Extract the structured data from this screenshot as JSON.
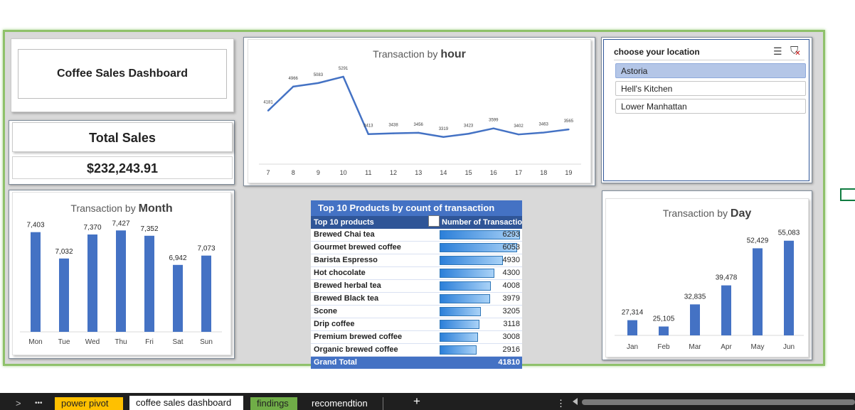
{
  "dashboard_title": "Coffee Sales Dashboard",
  "total_sales": {
    "label": "Total Sales",
    "value": "$232,243.91"
  },
  "hour_chart": {
    "title_prefix": "Transaction by ",
    "title_bold": "hour"
  },
  "month_chart": {
    "title_prefix": "Transaction by ",
    "title_bold": "Month"
  },
  "day_chart": {
    "title_prefix": "Transaction by ",
    "title_bold": "Day"
  },
  "chart_data": [
    {
      "type": "line",
      "title": "Transaction by hour",
      "x": [
        "7",
        "8",
        "9",
        "10",
        "11",
        "12",
        "13",
        "14",
        "15",
        "16",
        "17",
        "18",
        "19"
      ],
      "series": [
        {
          "values": [
            4181,
            4966,
            5083,
            5291,
            3413,
            3438,
            3456,
            3319,
            3423,
            3599,
            3402,
            3463,
            3565
          ],
          "color": "#4472c4"
        }
      ]
    },
    {
      "type": "bar",
      "title": "Transaction by Month",
      "categories": [
        "Mon",
        "Tue",
        "Wed",
        "Thu",
        "Fri",
        "Sat",
        "Sun"
      ],
      "values": [
        7403,
        7032,
        7370,
        7427,
        7352,
        6942,
        7073
      ],
      "labels": [
        "7,403",
        "7,032",
        "7,370",
        "7,427",
        "7,352",
        "6,942",
        "7,073"
      ],
      "color": "#4472c4"
    },
    {
      "type": "bar",
      "title": "Transaction by Day",
      "categories": [
        "Jan",
        "Feb",
        "Mar",
        "Apr",
        "May",
        "Jun"
      ],
      "values": [
        27314,
        25105,
        32835,
        39478,
        52429,
        55083
      ],
      "labels": [
        "27,314",
        "25,105",
        "32,835",
        "39,478",
        "52,429",
        "55,083"
      ],
      "color": "#4472c4"
    },
    {
      "type": "table",
      "title": "Top 10 Products by count of transaction",
      "columns": [
        "Top 10 products",
        "Number of Transactio"
      ],
      "rows": [
        {
          "product": "Brewed Chai tea",
          "count": "6293",
          "value": 6293
        },
        {
          "product": "Gourmet brewed coffee",
          "count": "6053",
          "value": 6053
        },
        {
          "product": "Barista Espresso",
          "count": "4930",
          "value": 4930
        },
        {
          "product": "Hot chocolate",
          "count": "4300",
          "value": 4300
        },
        {
          "product": "Brewed herbal tea",
          "count": "4008",
          "value": 4008
        },
        {
          "product": "Brewed Black tea",
          "count": "3979",
          "value": 3979
        },
        {
          "product": "Scone",
          "count": "3205",
          "value": 3205
        },
        {
          "product": "Drip coffee",
          "count": "3118",
          "value": 3118
        },
        {
          "product": "Premium brewed coffee",
          "count": "3008",
          "value": 3008
        },
        {
          "product": "Organic brewed coffee",
          "count": "2916",
          "value": 2916
        }
      ],
      "total_label": "Grand Total",
      "total_value": "41810"
    }
  ],
  "slicer": {
    "header": "choose your location",
    "items": [
      {
        "label": "Astoria",
        "selected": true
      },
      {
        "label": "Hell's Kitchen",
        "selected": false
      },
      {
        "label": "Lower Manhattan",
        "selected": false
      }
    ]
  },
  "tabs": {
    "nav_prev": ">",
    "nav_more": "•••",
    "items": [
      {
        "label": "power pivot",
        "color": "#ffc000",
        "active": false
      },
      {
        "label": "coffee sales dashboard",
        "color": "#ffffff",
        "active": true
      },
      {
        "label": "findings",
        "color": "#70ad47",
        "active": false
      },
      {
        "label": "recomendtion",
        "color": "",
        "active": false
      }
    ],
    "add": "+",
    "options": "⋮"
  },
  "colors": {
    "accent": "#4472c4",
    "frame": "#8fc16b",
    "table_header": "#2f5597",
    "tab_bg": "#1f1f1f"
  }
}
